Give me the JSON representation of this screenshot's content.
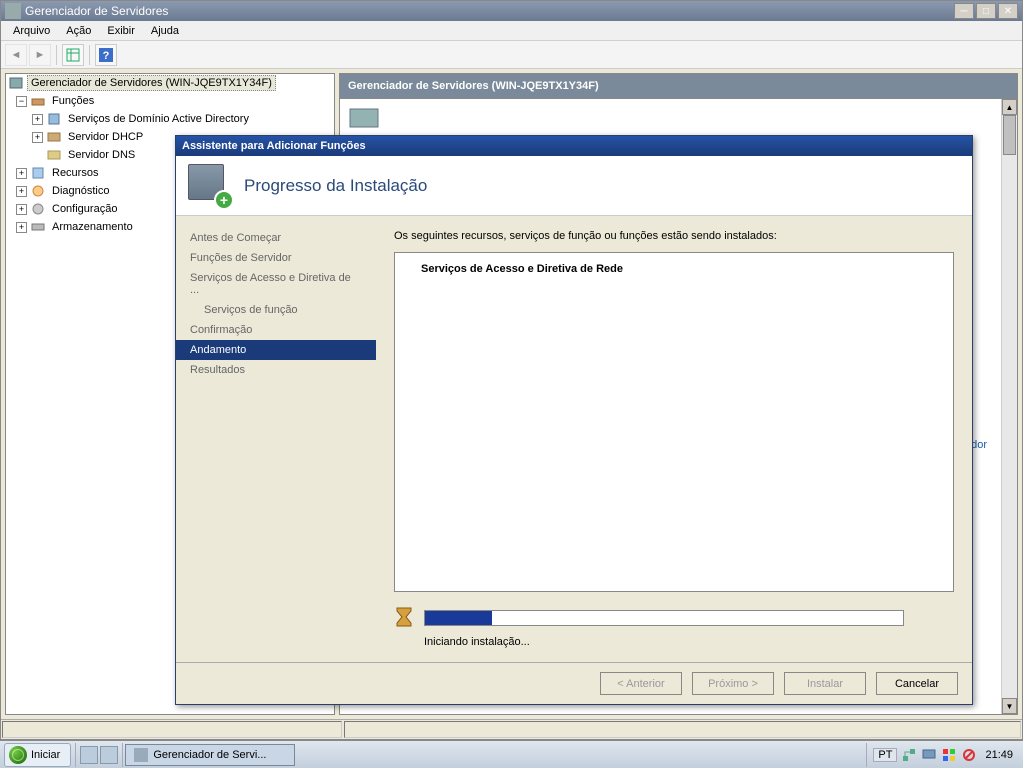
{
  "window": {
    "title": "Gerenciador de Servidores",
    "min_tip": "Minimize",
    "max_tip": "Maximize",
    "close_tip": "Close"
  },
  "menubar": {
    "items": [
      "Arquivo",
      "Ação",
      "Exibir",
      "Ajuda"
    ]
  },
  "tree": {
    "root": {
      "label": "Gerenciador de Servidores (WIN-JQE9TX1Y34F)"
    },
    "nodes": [
      {
        "label": "Funções",
        "exp": "-",
        "children": [
          {
            "label": "Serviços de Domínio Active Directory",
            "exp": "+"
          },
          {
            "label": "Servidor DHCP",
            "exp": "+"
          },
          {
            "label": "Servidor DNS",
            "exp": ""
          }
        ]
      },
      {
        "label": "Recursos",
        "exp": "+"
      },
      {
        "label": "Diagnóstico",
        "exp": "+"
      },
      {
        "label": "Configuração",
        "exp": "+"
      },
      {
        "label": "Armazenamento",
        "exp": "+"
      }
    ]
  },
  "content": {
    "header": "Gerenciador de Servidores (WIN-JQE9TX1Y34F)",
    "partial_link": "dor"
  },
  "wizard": {
    "title": "Assistente para Adicionar Funções",
    "header": "Progresso da Instalação",
    "steps": [
      "Antes de Começar",
      "Funções de Servidor",
      "Serviços de Acesso e Diretiva de ...",
      "Serviços de função",
      "Confirmação",
      "Andamento",
      "Resultados"
    ],
    "active_step": 5,
    "sub_steps": [
      3
    ],
    "message": "Os seguintes recursos, serviços de função ou funções estão sendo instalados:",
    "install_item": "Serviços de Acesso e Diretiva de Rede",
    "status": "Iniciando instalação...",
    "buttons": {
      "back": "< Anterior",
      "next": "Próximo >",
      "install": "Instalar",
      "cancel": "Cancelar"
    }
  },
  "taskbar": {
    "start": "Iniciar",
    "task1": "Gerenciador de Servi...",
    "lang": "PT",
    "clock": "21:49"
  }
}
